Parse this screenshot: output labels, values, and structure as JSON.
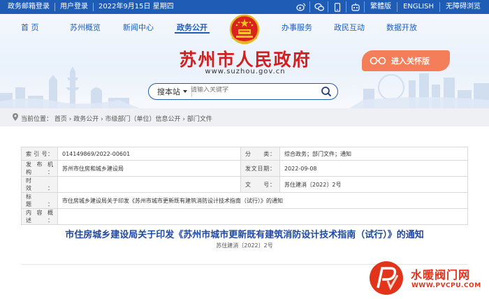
{
  "topbar": {
    "left": [
      "政务邮箱登录",
      "用户登录",
      "2022年9月15日 星期四"
    ],
    "right": [
      "繁體版",
      "ENGLISH",
      "无障碍浏览"
    ],
    "icons": [
      "weibo-icon",
      "wechat-icon",
      "mobile-icon",
      "robot-icon"
    ]
  },
  "nav": {
    "items": [
      "首 页",
      "苏州概览",
      "新闻中心",
      "政务公开",
      "办事服务",
      "政民互动",
      "数据开放"
    ],
    "active": "政务公开"
  },
  "site": {
    "title": "苏州市人民政府",
    "url": "www.suzhou.gov.cn",
    "care_button": "进入关怀版"
  },
  "search": {
    "selector": "搜本站",
    "placeholder": "请输入关键字"
  },
  "breadcrumb": {
    "label": "当前位置：",
    "path": "首页 › 政务公开 › 市级部门（单位）信息公开 › 部门文件"
  },
  "info_table": {
    "rows": [
      {
        "l1": "索 引 号：",
        "v1": "014149869/2022-00601",
        "l2": "分　　类：",
        "v2": "综合政务；部门文件；通知"
      },
      {
        "l1": "发布机构：",
        "v1": "苏州市住房和城乡建设局",
        "l2": "发文日期：",
        "v2": "2022-09-08"
      },
      {
        "l1": "时　　效：",
        "v1": "",
        "l2": "文　　号：",
        "v2": "苏住建消〔2022〕2号"
      }
    ],
    "title_label": "标　　题：",
    "title_value": "市住房城乡建设局关于印发《苏州市城市更新既有建筑消防设计技术指南（试行）》的通知",
    "summary_label": "内容概述：",
    "summary_value": ""
  },
  "document": {
    "title": "市住房城乡建设局关于印发《苏州市城市更新既有建筑消防设计技术指南（试行）》的通知",
    "number": "苏住建消〔2022〕2号"
  },
  "watermark": {
    "text": "水暖阀门网",
    "url": "WWW.PVCPU.COM"
  },
  "colors": {
    "brand_blue": "#1f5cb5",
    "title_red": "#d11f1f",
    "care_orange": "#f47d5a",
    "watermark_red": "#e2331b"
  }
}
